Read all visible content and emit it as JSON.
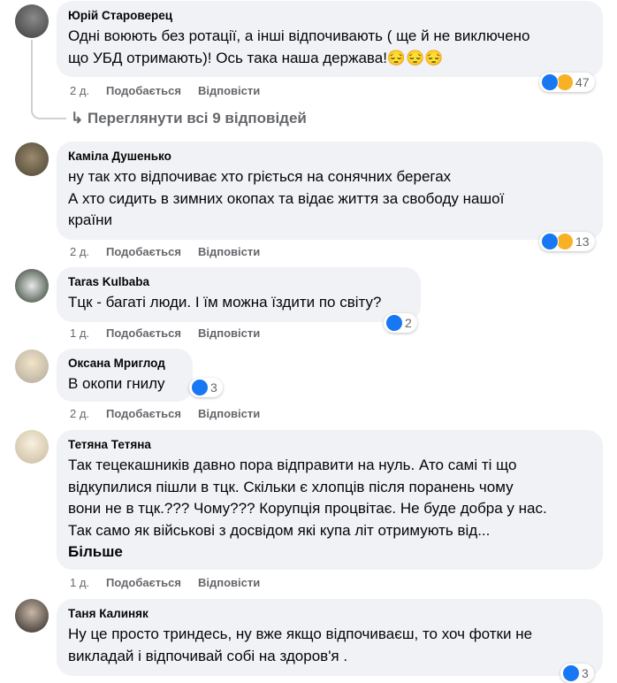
{
  "comments": [
    {
      "name": "Юрій Староверец",
      "text": "Одні воюють без ротації, а інші відпочивають ( ще й не виключено\nщо УБД отримають)! Ось така наша держава!😔😔😔",
      "time": "2 д.",
      "like": "Подобається",
      "reply": "Відповісти",
      "reactions": "47"
    },
    {
      "name": "Каміла Душенько",
      "text": "ну так хто відпочиває хто гріється на сонячних берегах\nА хто сидить в зимних окопах та відає життя за свободу нашої\nкраїни",
      "time": "2 д.",
      "like": "Подобається",
      "reply": "Відповісти",
      "reactions": "13"
    },
    {
      "name": "Taras Kulbaba",
      "text": "Тцк - багаті люди. І їм можна їздити по світу?",
      "time": "1 д.",
      "like": "Подобається",
      "reply": "Відповісти",
      "reactions": "2"
    },
    {
      "name": "Оксана Мриглод",
      "text": "В окопи гнилу",
      "time": "2 д.",
      "like": "Подобається",
      "reply": "Відповісти",
      "reactions": "3"
    },
    {
      "name": "Тетяна Тетяна",
      "text": "Так тецекашників давно пора відправити на нуль. Ато самі ті що\nвідкупилися пішли в тцк. Скільки є хлопців після поранень чому\nвони не в тцк.??? Чому??? Корупція процвітає. Не буде добра у нас.\nТак само як військові з досвідом які купа літ отримують від...",
      "more": "Більше",
      "time": "1 д.",
      "like": "Подобається",
      "reply": "Відповісти"
    },
    {
      "name": "Таня Калиняк",
      "text": "Ну це просто триндесь, ну вже якщо відпочиваєш, то хоч фотки не\nвикладай і відпочивай собі на здоров'я .",
      "reactions": "3"
    }
  ],
  "view_replies": "Переглянути всі 9 відповідей",
  "colors": {
    "bubble": "#f0f2f5",
    "meta": "#65676b",
    "like": "#1877f2",
    "sad": "#f7b125"
  }
}
